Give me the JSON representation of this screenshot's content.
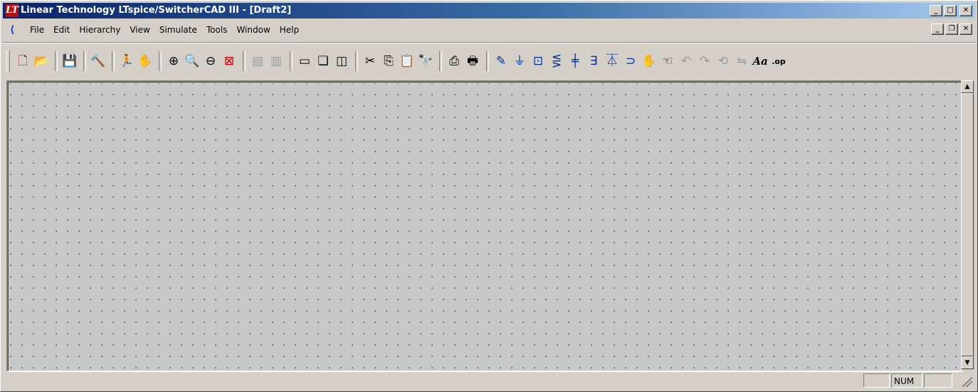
{
  "window": {
    "title": "Linear Technology LTspice/SwitcherCAD III - [Draft2]",
    "logo_glyph": "LT",
    "buttons": {
      "minimize": "_",
      "maximize": "□",
      "close": "✕"
    }
  },
  "menubar": {
    "items": [
      {
        "label": "File"
      },
      {
        "label": "Edit"
      },
      {
        "label": "Hierarchy"
      },
      {
        "label": "View"
      },
      {
        "label": "Simulate"
      },
      {
        "label": "Tools"
      },
      {
        "label": "Window"
      },
      {
        "label": "Help"
      }
    ],
    "mdi_buttons": {
      "minimize": "_",
      "restore": "❐",
      "close": "✕"
    }
  },
  "toolbar": {
    "icons": [
      {
        "name": "new-schematic-icon",
        "glyph": "🗋"
      },
      {
        "name": "open-icon",
        "glyph": "📂"
      },
      {
        "name": "save-icon",
        "glyph": "💾"
      },
      {
        "name": "control-panel-icon",
        "glyph": "🔨"
      },
      {
        "name": "run-icon",
        "glyph": "🏃"
      },
      {
        "name": "halt-icon",
        "glyph": "✋"
      },
      {
        "name": "zoom-in-icon",
        "glyph": "⊕"
      },
      {
        "name": "pan-icon",
        "glyph": "🔍"
      },
      {
        "name": "zoom-out-icon",
        "glyph": "⊖"
      },
      {
        "name": "zoom-fit-icon",
        "glyph": "⊠"
      },
      {
        "name": "autorange-icon",
        "glyph": "▤"
      },
      {
        "name": "delete-traces-icon",
        "glyph": "▥"
      },
      {
        "name": "tile-horizontal-icon",
        "glyph": "▭"
      },
      {
        "name": "cascade-icon",
        "glyph": "❏"
      },
      {
        "name": "tile-vertical-icon",
        "glyph": "◫"
      },
      {
        "name": "cut-icon",
        "glyph": "✂"
      },
      {
        "name": "copy-icon",
        "glyph": "⎘"
      },
      {
        "name": "paste-icon",
        "glyph": "📋"
      },
      {
        "name": "find-icon",
        "glyph": "🔭"
      },
      {
        "name": "print-preview-icon",
        "glyph": "⎙"
      },
      {
        "name": "print-icon",
        "glyph": "🖶"
      },
      {
        "name": "wire-icon",
        "glyph": "✎"
      },
      {
        "name": "ground-icon",
        "glyph": "⏚"
      },
      {
        "name": "label-net-icon",
        "glyph": "⊡"
      },
      {
        "name": "resistor-icon",
        "glyph": "⋚"
      },
      {
        "name": "capacitor-icon",
        "glyph": "╪"
      },
      {
        "name": "inductor-icon",
        "glyph": "∃"
      },
      {
        "name": "diode-icon",
        "glyph": "⏄"
      },
      {
        "name": "component-icon",
        "glyph": "⊃"
      },
      {
        "name": "move-icon",
        "glyph": "✋"
      },
      {
        "name": "drag-icon",
        "glyph": "☜"
      },
      {
        "name": "undo-icon",
        "glyph": "↶"
      },
      {
        "name": "redo-icon",
        "glyph": "↷"
      },
      {
        "name": "rotate-icon",
        "glyph": "⟲"
      },
      {
        "name": "mirror-icon",
        "glyph": "⇋"
      },
      {
        "name": "text-icon",
        "glyph": "Aa"
      },
      {
        "name": "spice-directive-icon",
        "glyph": ".op"
      }
    ]
  },
  "statusbar": {
    "message": "",
    "pane1": "",
    "num_indicator": "NUM",
    "pane3": ""
  }
}
